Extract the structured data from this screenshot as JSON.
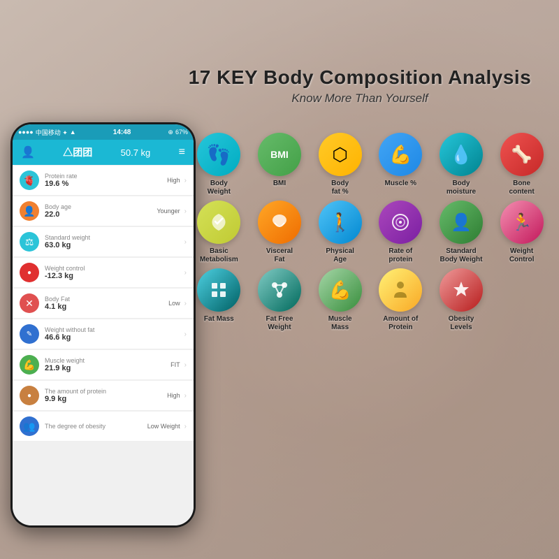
{
  "background": {
    "color": "#c9b8a8"
  },
  "header": {
    "main_title": "17 KEY Body Composition Analysis",
    "sub_title": "Know More Than Yourself"
  },
  "phone": {
    "status_bar": {
      "carrier": "中国移动 ✦",
      "time": "14:48",
      "battery": "67%",
      "icons": "📶 🔵"
    },
    "nav": {
      "back_icon": "👤",
      "title": "△团团",
      "weight": "50.7 kg",
      "menu_icon": "≡"
    },
    "list_items": [
      {
        "label": "Protein rate",
        "value": "19.6 %",
        "badge": "High",
        "icon": "🫀",
        "icon_color": "icon-teal"
      },
      {
        "label": "Body age",
        "value": "22.0",
        "badge": "Younger",
        "icon": "👤",
        "icon_color": "icon-orange"
      },
      {
        "label": "Standard weight",
        "value": "63.0 kg",
        "badge": "",
        "icon": "⚖",
        "icon_color": "icon-teal"
      },
      {
        "label": "Weight control",
        "value": "-12.3 kg",
        "badge": "",
        "icon": "🔴",
        "icon_color": "icon-red"
      },
      {
        "label": "Body Fat",
        "value": "4.1 kg",
        "badge": "Low",
        "icon": "❌",
        "icon_color": "icon-red2"
      },
      {
        "label": "Weight without fat",
        "value": "46.6 kg",
        "badge": "",
        "icon": "✏",
        "icon_color": "icon-blue"
      },
      {
        "label": "Muscle weight",
        "value": "21.9 kg",
        "badge": "FIT",
        "icon": "💪",
        "icon_color": "icon-green"
      },
      {
        "label": "The amount of protein",
        "value": "9.9 kg",
        "badge": "High",
        "icon": "🟤",
        "icon_color": "icon-brown"
      },
      {
        "label": "The degree of obesity",
        "value": "",
        "badge": "Low Weight",
        "icon": "👥",
        "icon_color": "icon-blue"
      }
    ]
  },
  "icons_grid": {
    "rows": [
      [
        {
          "label": "Body\nWeight",
          "emoji": "👣",
          "bubble": "bubble-cyan"
        },
        {
          "label": "BMI",
          "emoji": "BMI",
          "bubble": "bubble-green",
          "is_text": true
        },
        {
          "label": "Body\nfat %",
          "emoji": "⬡",
          "bubble": "bubble-yellow"
        },
        {
          "label": "Muscle %",
          "emoji": "💪",
          "bubble": "bubble-blue"
        },
        {
          "label": "Body\nmoisture",
          "emoji": "💧",
          "bubble": "bubble-teal"
        },
        {
          "label": "Bone\ncontent",
          "emoji": "🦴",
          "bubble": "bubble-red"
        }
      ],
      [
        {
          "label": "Basic\nMetabolism",
          "emoji": "🔥",
          "bubble": "bubble-lime"
        },
        {
          "label": "Visceral\nFat",
          "emoji": "🫁",
          "bubble": "bubble-orange"
        },
        {
          "label": "Physical\nAge",
          "emoji": "🚶",
          "bubble": "bubble-lightblue"
        },
        {
          "label": "Rate of\nprotein",
          "emoji": "⚙",
          "bubble": "bubble-purple"
        },
        {
          "label": "Standard\nBody Weight",
          "emoji": "👥",
          "bubble": "bubble-green2"
        },
        {
          "label": "Weight\nControl",
          "emoji": "🏃",
          "bubble": "bubble-pink"
        }
      ],
      [
        {
          "label": "Fat Mass",
          "emoji": "⬛",
          "bubble": "bubble-cyan2"
        },
        {
          "label": "Fat Free\nWeight",
          "emoji": "🔗",
          "bubble": "bubble-teal2"
        },
        {
          "label": "Muscle\nMass",
          "emoji": "💪",
          "bubble": "bubble-green3"
        },
        {
          "label": "Amount of\nProtein",
          "emoji": "🔬",
          "bubble": "bubble-yellow2"
        },
        {
          "label": "Obesity\nLevels",
          "emoji": "⭐",
          "bubble": "bubble-red2"
        }
      ]
    ]
  }
}
